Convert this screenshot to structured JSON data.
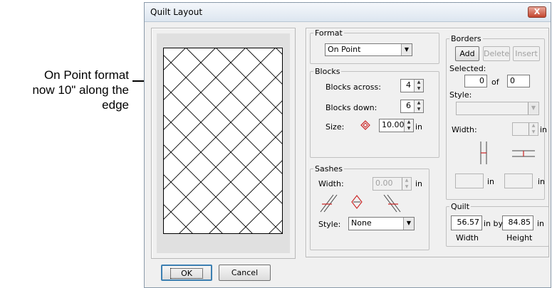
{
  "annotation": {
    "text": "On Point format\nnow 10\" along the\nedge"
  },
  "dialog": {
    "title": "Quilt Layout",
    "close_label": "X"
  },
  "format": {
    "legend": "Format",
    "selected": "On Point"
  },
  "blocks": {
    "legend": "Blocks",
    "across_label": "Blocks across:",
    "across_value": "4",
    "down_label": "Blocks down:",
    "down_value": "6",
    "size_label": "Size:",
    "size_value": "10.00",
    "size_unit": "in"
  },
  "sashes": {
    "legend": "Sashes",
    "width_label": "Width:",
    "width_value": "0.00",
    "width_unit": "in",
    "style_label": "Style:",
    "style_value": "None"
  },
  "borders": {
    "legend": "Borders",
    "add_label": "Add",
    "delete_label": "Delete",
    "insert_label": "Insert",
    "selected_label": "Selected:",
    "selected_value": "0",
    "of_label": "of",
    "total_value": "0",
    "style_label": "Style:",
    "style_value": "",
    "width_label": "Width:",
    "width_value": "",
    "width_unit": "in",
    "side_value": "",
    "side_unit": "in",
    "top_value": "",
    "top_unit": "in"
  },
  "quilt": {
    "legend": "Quilt",
    "width_value": "56.57",
    "in_by_label": "in by",
    "height_value": "84.85",
    "unit": "in",
    "width_caption": "Width",
    "height_caption": "Height"
  },
  "buttons": {
    "ok": "OK",
    "cancel": "Cancel"
  },
  "colors": {
    "accent_red": "#cc2222",
    "dialog_bg": "#f0f0f0"
  }
}
